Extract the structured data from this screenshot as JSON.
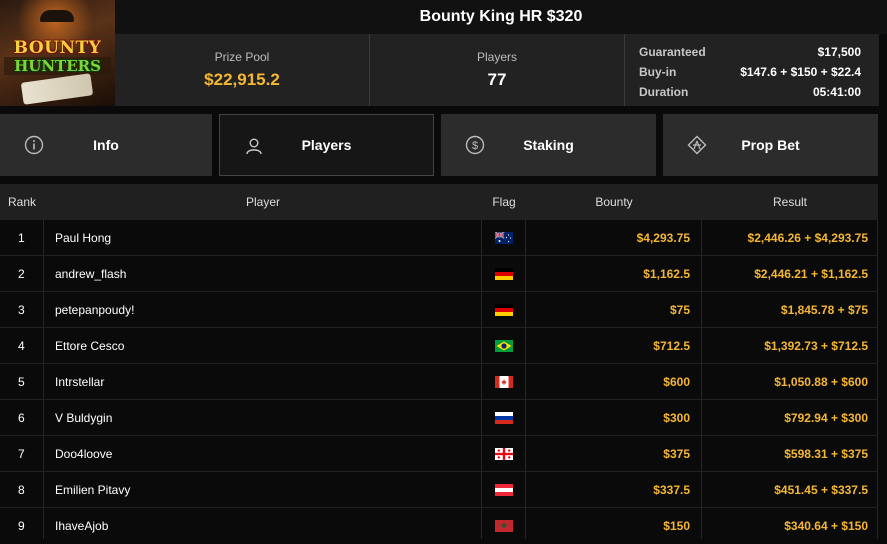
{
  "tournament": {
    "title": "Bounty King HR $320",
    "logo_line1": "BOUNTY",
    "logo_line2": "HUNTERS"
  },
  "stats": {
    "prize_pool_label": "Prize Pool",
    "prize_pool_value": "$22,915.2",
    "players_label": "Players",
    "players_value": "77"
  },
  "details": [
    {
      "key": "Guaranteed",
      "value": "$17,500"
    },
    {
      "key": "Buy-in",
      "value": "$147.6 + $150 + $22.4"
    },
    {
      "key": "Duration",
      "value": "05:41:00"
    }
  ],
  "tabs": [
    {
      "label": "Info",
      "icon": "info-circle-icon",
      "active": false
    },
    {
      "label": "Players",
      "icon": "user-icon",
      "active": true
    },
    {
      "label": "Staking",
      "icon": "dollar-coin-icon",
      "active": false
    },
    {
      "label": "Prop Bet",
      "icon": "diamond-bet-icon",
      "active": false
    }
  ],
  "columns": {
    "rank": "Rank",
    "player": "Player",
    "flag": "Flag",
    "bounty": "Bounty",
    "result": "Result"
  },
  "rows": [
    {
      "rank": "1",
      "player": "Paul Hong",
      "flag": "AU",
      "bounty": "$4,293.75",
      "result": "$2,446.26 + $4,293.75"
    },
    {
      "rank": "2",
      "player": "andrew_flash",
      "flag": "DE",
      "bounty": "$1,162.5",
      "result": "$2,446.21 + $1,162.5"
    },
    {
      "rank": "3",
      "player": "petepanpoudy!",
      "flag": "DE",
      "bounty": "$75",
      "result": "$1,845.78 + $75"
    },
    {
      "rank": "4",
      "player": "Ettore Cesco",
      "flag": "BR",
      "bounty": "$712.5",
      "result": "$1,392.73 + $712.5"
    },
    {
      "rank": "5",
      "player": "Intrstellar",
      "flag": "CA",
      "bounty": "$600",
      "result": "$1,050.88 + $600"
    },
    {
      "rank": "6",
      "player": "V Buldygin",
      "flag": "RU",
      "bounty": "$300",
      "result": "$792.94 + $300"
    },
    {
      "rank": "7",
      "player": "Doo4loove",
      "flag": "GE",
      "bounty": "$375",
      "result": "$598.31 + $375"
    },
    {
      "rank": "8",
      "player": "Emilien Pitavy",
      "flag": "AT",
      "bounty": "$337.5",
      "result": "$451.45 + $337.5"
    },
    {
      "rank": "9",
      "player": "IhaveAjob",
      "flag": "MA",
      "bounty": "$150",
      "result": "$340.64 + $150"
    }
  ],
  "colors": {
    "accent_gold": "#f5b731",
    "background": "#0a0a0a",
    "panel": "#222222"
  }
}
